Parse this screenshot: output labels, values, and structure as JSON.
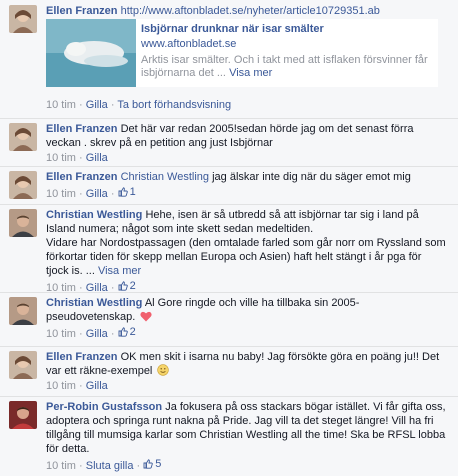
{
  "comments": [
    {
      "author": "Ellen Franzen",
      "url": "http://www.aftonbladet.se/nyheter/article10729351.ab",
      "preview": {
        "title": "Isbjörnar drunknar när isar smälter",
        "domain": "www.aftonbladet.se",
        "desc": "Arktis isar smälter. Och i takt med att isflaken försvinner får isbjörnarna det ...",
        "see_more": "Visa mer"
      },
      "time": "10 tim",
      "like": "Gilla",
      "remove": "Ta bort förhandsvisning"
    },
    {
      "author": "Ellen Franzen",
      "text": "Det här var redan 2005!sedan hörde jag om det senast förra veckan . skrev på en petition ang just Isbjörnar",
      "time": "10 tim",
      "like": "Gilla"
    },
    {
      "author": "Ellen Franzen",
      "mention": "Christian Westling",
      "text": " jag älskar inte dig när du säger emot mig",
      "time": "10 tim",
      "like": "Gilla",
      "likes": "1"
    },
    {
      "author": "Christian Westling",
      "text": "Hehe, isen är så utbredd så att isbjörnar tar sig i land på Island numera; något som inte skett sedan medeltiden.",
      "text2": "Vidare har Nordostpassagen (den omtalade farled som går norr om Ryssland som förkortar tiden för skepp mellan Europa och Asien) haft helt stängt i år pga för tjock is. ...",
      "see_more": "Visa mer",
      "time": "10 tim",
      "like": "Gilla",
      "likes": "2"
    },
    {
      "author": "Christian Westling",
      "text": "Al Gore ringde och ville ha tillbaka sin 2005-pseudovetenskap.",
      "time": "10 tim",
      "like": "Gilla",
      "likes": "2"
    },
    {
      "author": "Ellen Franzen",
      "text": "OK men skit i isarna nu baby! Jag försökte göra en poäng ju!! Det var ett räkne-exempel",
      "time": "10 tim",
      "like": "Gilla"
    },
    {
      "author": "Per-Robin Gustafsson",
      "text": "Ja fokusera på oss stackars bögar istället. Vi får gifta oss, adoptera och springa runt nakna på Pride. Jag vill ta det steget längre! Vill ha fri tillgång till mumsiga karlar som Christian Westling all the time! Ska be RFSL lobba för detta.",
      "time": "10 tim",
      "like": "Sluta gilla",
      "likes": "5"
    }
  ],
  "colors": {
    "link": "#3b5998",
    "muted": "#90949c",
    "heart": "#f0606e"
  }
}
